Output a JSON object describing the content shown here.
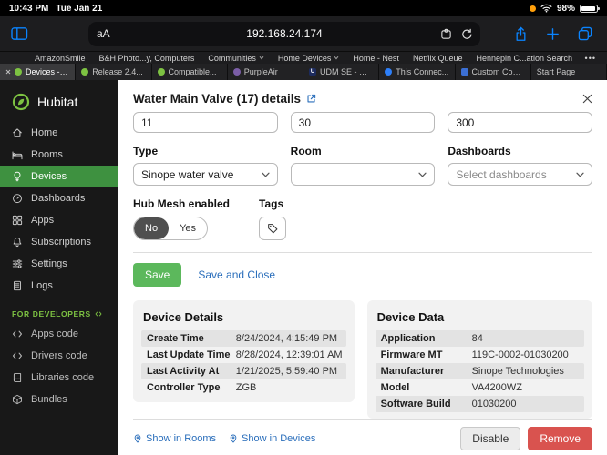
{
  "colors": {
    "ios_accent_blue": "#0a84ff",
    "hubitat_green": "#7dc242",
    "sidebar_active_green": "#3e9140",
    "save_green": "#5cb85c",
    "remove_red": "#d9534f",
    "link_blue": "#2a6ebb"
  },
  "status_bar": {
    "time": "10:43 PM",
    "date": "Tue Jan 21",
    "battery_percent": "98%"
  },
  "toolbar": {
    "reader_button": "aA",
    "url": "192.168.24.174"
  },
  "favorites": {
    "items": [
      {
        "label": "AmazonSmile"
      },
      {
        "label": "B&H Photo...y, Computers"
      },
      {
        "label": "Communities"
      },
      {
        "label": "Home Devices"
      },
      {
        "label": "Home - Nest"
      },
      {
        "label": "Netflix Queue"
      },
      {
        "label": "Hennepin C...ation Search"
      }
    ]
  },
  "tabs": [
    {
      "label": "Devices - En...",
      "active": true
    },
    {
      "label": "Release 2.4..."
    },
    {
      "label": "Compatible..."
    },
    {
      "label": "PurpleAir"
    },
    {
      "label": "UDM SE - Un...",
      "favicon_text": "U"
    },
    {
      "label": "This Connec..."
    },
    {
      "label": "Custom Com..."
    },
    {
      "label": "Start Page"
    }
  ],
  "sidebar": {
    "brand": "Hubitat",
    "items": [
      {
        "label": "Home",
        "icon": "home"
      },
      {
        "label": "Rooms",
        "icon": "bed"
      },
      {
        "label": "Devices",
        "icon": "bulb",
        "active": true
      },
      {
        "label": "Dashboards",
        "icon": "gauge"
      },
      {
        "label": "Apps",
        "icon": "grid"
      },
      {
        "label": "Subscriptions",
        "icon": "bell"
      },
      {
        "label": "Settings",
        "icon": "sliders"
      },
      {
        "label": "Logs",
        "icon": "document"
      }
    ],
    "dev_header": "FOR DEVELOPERS",
    "dev_items": [
      {
        "label": "Apps code",
        "icon": "code"
      },
      {
        "label": "Drivers code",
        "icon": "code"
      },
      {
        "label": "Libraries code",
        "icon": "book"
      },
      {
        "label": "Bundles",
        "icon": "box"
      }
    ]
  },
  "panel": {
    "title": "Water Main Valve (17) details",
    "top_inputs": {
      "first": "11",
      "second": "30",
      "third": "300"
    },
    "type_label": "Type",
    "type_value": "Sinope water valve",
    "room_label": "Room",
    "room_value": "",
    "dashboards_label": "Dashboards",
    "dashboards_placeholder": "Select dashboards",
    "hub_mesh_label": "Hub Mesh enabled",
    "hub_mesh_no": "No",
    "hub_mesh_yes": "Yes",
    "hub_mesh_selected": "No",
    "tags_label": "Tags",
    "save_label": "Save",
    "save_close_label": "Save and Close",
    "device_details": {
      "title": "Device Details",
      "rows": [
        {
          "label": "Create Time",
          "value": "8/24/2024, 4:15:49 PM"
        },
        {
          "label": "Last Update Time",
          "value": "8/28/2024, 12:39:01 AM"
        },
        {
          "label": "Last Activity At",
          "value": "1/21/2025, 5:59:40 PM"
        },
        {
          "label": "Controller Type",
          "value": "ZGB"
        }
      ]
    },
    "device_data": {
      "title": "Device Data",
      "rows": [
        {
          "label": "Application",
          "value": "84"
        },
        {
          "label": "Firmware MT",
          "value": "119C-0002-01030200"
        },
        {
          "label": "Manufacturer",
          "value": "Sinope Technologies"
        },
        {
          "label": "Model",
          "value": "VA4200WZ"
        },
        {
          "label": "Software Build",
          "value": "01030200"
        }
      ]
    },
    "footer": {
      "show_in_rooms": "Show in Rooms",
      "show_in_devices": "Show in Devices",
      "disable_label": "Disable",
      "remove_label": "Remove"
    }
  }
}
